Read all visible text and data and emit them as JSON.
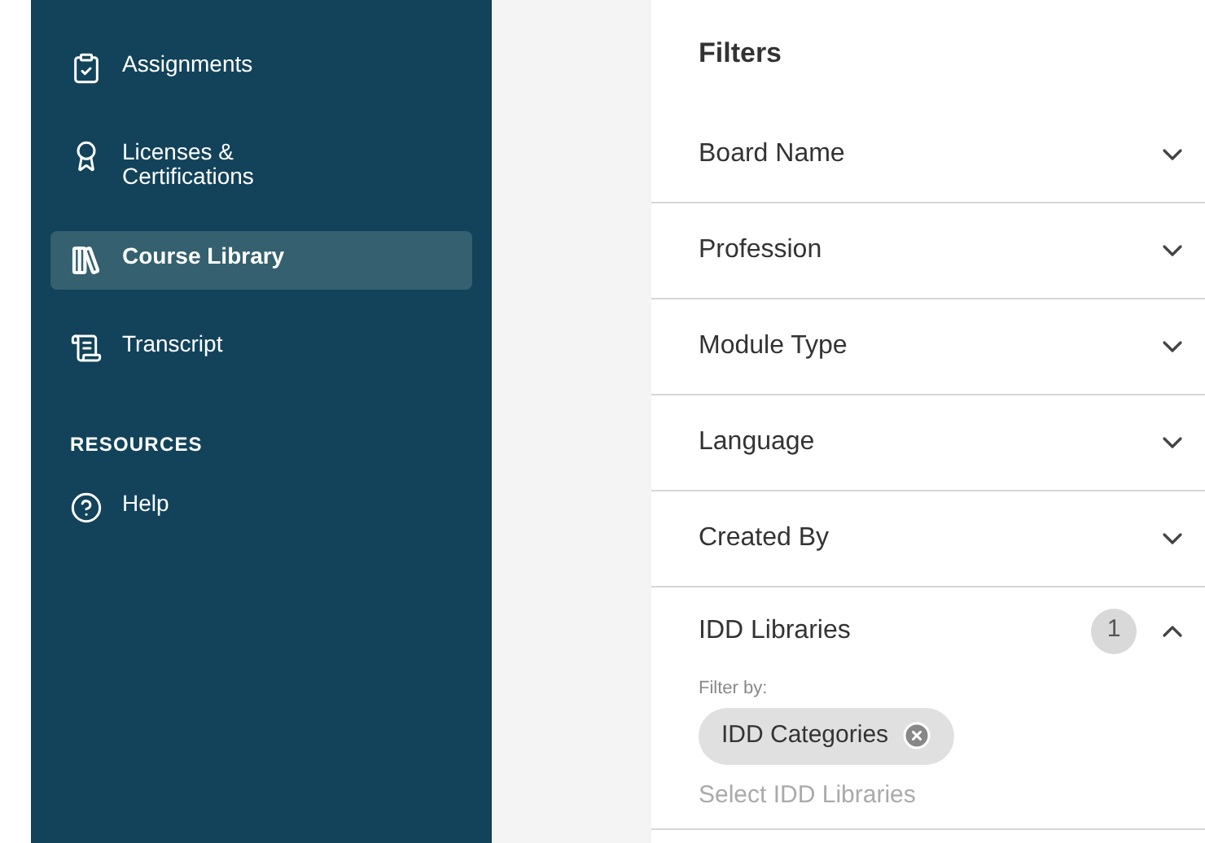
{
  "sidebar": {
    "items": [
      {
        "kind": "assignments",
        "label": "Assignments",
        "selected": false
      },
      {
        "kind": "licenses",
        "label": "Licenses &\nCertifications",
        "selected": false
      },
      {
        "kind": "library",
        "label": "Course Library",
        "selected": true
      },
      {
        "kind": "transcript",
        "label": "Transcript",
        "selected": false
      }
    ],
    "section_heading": "RESOURCES",
    "resource_items": [
      {
        "kind": "help",
        "label": "Help",
        "selected": false
      }
    ]
  },
  "filters": {
    "title": "Filters",
    "groups": [
      {
        "label": "Board Name",
        "expanded": false
      },
      {
        "label": "Profession",
        "expanded": false
      },
      {
        "label": "Module Type",
        "expanded": false
      },
      {
        "label": "Language",
        "expanded": false
      },
      {
        "label": "Created By",
        "expanded": false
      },
      {
        "label": "IDD Libraries",
        "expanded": true,
        "count": "1",
        "filter_by_label": "Filter by:",
        "chips": [
          "IDD Categories"
        ],
        "placeholder": "Select IDD Libraries"
      }
    ]
  }
}
